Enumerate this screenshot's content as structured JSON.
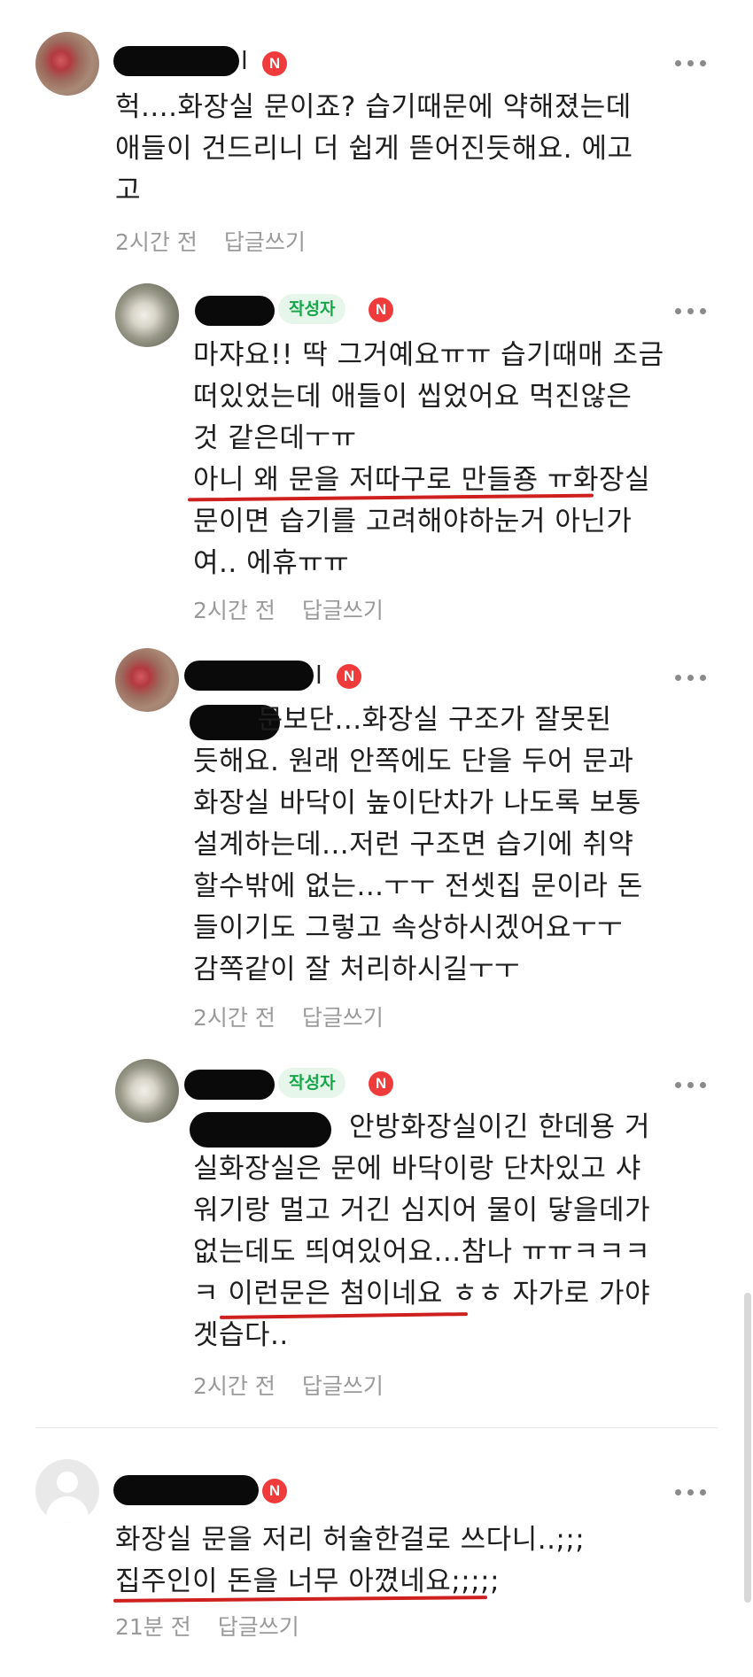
{
  "comments": [
    {
      "badge": "N",
      "name_suffix": "l",
      "body": "헉....화장실 문이죠? 습기때문에 약해졌는데\n애들이 건드리니 더 쉽게 뜯어진듯해요. 에고\n고",
      "time": "2시간 전",
      "reply": "답글쓰기"
    },
    {
      "author_tag": "작성자",
      "badge": "N",
      "body": "마쟈요!! 딱 그거예요ㅠㅠ 습기때매 조금\n떠있었는데 애들이 씹었어요 먹진않은\n것 같은데ㅜㅠ\n아니 왜 문을 저따구로 만들죵 ㅠ화장실\n문이면 습기를 고려해야하눈거 아닌가\n여.. 에휴ㅠㅠ",
      "time": "2시간 전",
      "reply": "답글쓰기"
    },
    {
      "badge": "N",
      "name_suffix": "l",
      "body": "       문보단...화장실 구조가 잘못된\n듯해요. 원래 안쪽에도 단을 두어 문과\n화장실 바닥이 높이단차가 나도록 보통\n설계하는데...저런 구조면 습기에 취약\n할수밖에 없는...ㅜㅜ 전셋집 문이라 돈\n들이기도 그렇고 속상하시겠어요ㅜㅜ\n감쪽같이 잘 처리하시길ㅜㅜ",
      "time": "2시간 전",
      "reply": "답글쓰기"
    },
    {
      "author_tag": "작성자",
      "badge": "N",
      "body": "                 안방화장실이긴 한데용 거\n실화장실은 문에 바닥이랑 단차있고 샤\n워기랑 멀고 거긴 심지어 물이 닿을데가\n없는데도 띄여있어요...참나 ㅠㅠㅋㅋㅋ\nㅋ 이런문은 첨이네요 ㅎㅎ 자가로 가야\n겟습다..",
      "time": "2시간 전",
      "reply": "답글쓰기"
    },
    {
      "badge": "N",
      "body": "화장실 문을 저리 허술한걸로 쓰다니..;;;\n집주인이 돈을 너무 아꼈네요;;;;;",
      "time": "21분 전",
      "reply": "답글쓰기"
    }
  ],
  "icons": {
    "more": "more-dots-icon",
    "avatar_default": "default-user-icon"
  },
  "colors": {
    "badge_red": "#ef3b3b",
    "author_green": "#18a64a",
    "underline_red": "#cf2020"
  }
}
